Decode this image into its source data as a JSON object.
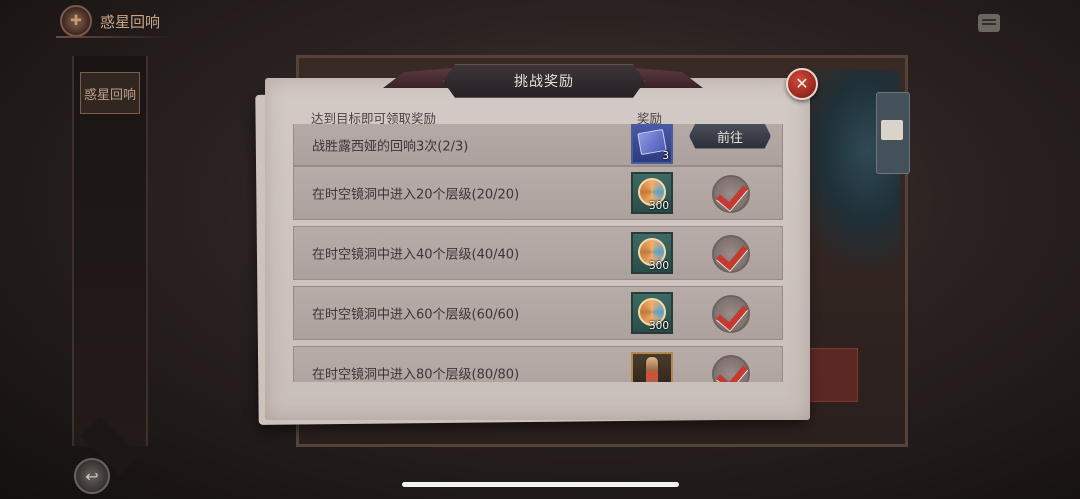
{
  "background": {
    "title": "惑星回响",
    "left_badge": "惑星回响"
  },
  "dialog": {
    "title": "挑战奖励",
    "header_goal": "达到目标即可领取奖励",
    "header_reward": "奖励",
    "close_symbol": "✕",
    "rows": [
      {
        "text": "战胜露西娅的回响3次(2/3)",
        "reward_icon": "spellbook-icon",
        "reward_count": "3",
        "action": "go",
        "action_label": "前往"
      },
      {
        "text": "在时空镜洞中进入20个层级(20/20)",
        "reward_icon": "vortex-orb-icon",
        "reward_count": "300",
        "action": "claimed"
      },
      {
        "text": "在时空镜洞中进入40个层级(40/40)",
        "reward_icon": "vortex-orb-icon",
        "reward_count": "300",
        "action": "claimed"
      },
      {
        "text": "在时空镜洞中进入60个层级(60/60)",
        "reward_icon": "vortex-orb-icon",
        "reward_count": "300",
        "action": "claimed"
      },
      {
        "text": "在时空镜洞中进入80个层级(80/80)",
        "reward_icon": "scroll-icon",
        "reward_count": "",
        "action": "claimed"
      }
    ]
  },
  "colors": {
    "accent_red": "#c43a30",
    "paper": "#d3cac5",
    "row": "#b1a6a2"
  }
}
